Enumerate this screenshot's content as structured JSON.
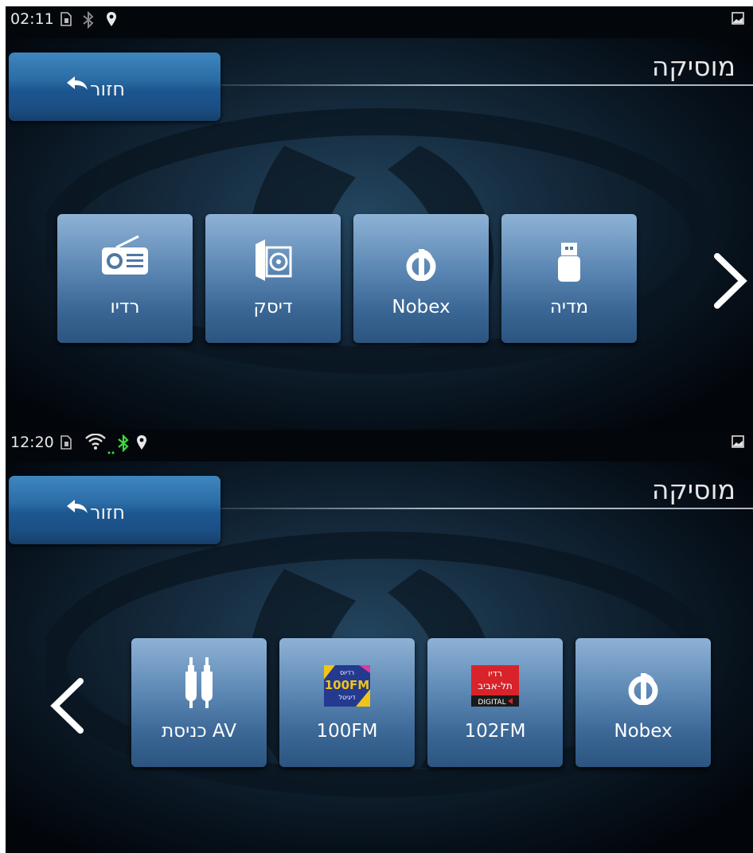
{
  "screens": [
    {
      "status": {
        "time": "02:11",
        "icons": [
          "sim-alert-icon",
          "bluetooth-icon",
          "location-pin-icon",
          "gallery-icon"
        ]
      },
      "title": "מוסיקה",
      "back_label": "חזור",
      "tiles": [
        {
          "label": "מדיה",
          "icon": "usb-icon"
        },
        {
          "label": "Nobex",
          "icon": "nobex-icon"
        },
        {
          "label": "דיסק",
          "icon": "disc-icon"
        },
        {
          "label": "רדיו",
          "icon": "radio-icon"
        }
      ],
      "nav": "next-page-arrow-icon"
    },
    {
      "status": {
        "time": "12:20",
        "icons": [
          "sim-alert-icon",
          "wifi-icon",
          "bluetooth-icon",
          "location-pin-icon",
          "gallery-icon"
        ]
      },
      "title": "מוסיקה",
      "back_label": "חזור",
      "tiles": [
        {
          "label": "Nobex",
          "icon": "nobex-icon"
        },
        {
          "label": "102FM",
          "icon": "radio-tel-aviv-logo",
          "logo_text": [
            "רדיו",
            "תל-אביב",
            "DIGITAL"
          ]
        },
        {
          "label": "100FM",
          "icon": "100fm-logo",
          "logo_text": [
            "רדיוס",
            "100FM",
            "דיגיטל"
          ]
        },
        {
          "label": "כניסת AV",
          "icon": "av-cable-icon"
        }
      ],
      "nav": "previous-page-arrow-icon"
    }
  ],
  "colors": {
    "accent": "#2b6ca5",
    "tile_top": "#8eb2d5",
    "tile_bottom": "#2c547f",
    "bluetooth_active": "#3ddc3d",
    "background": "#03070b"
  }
}
